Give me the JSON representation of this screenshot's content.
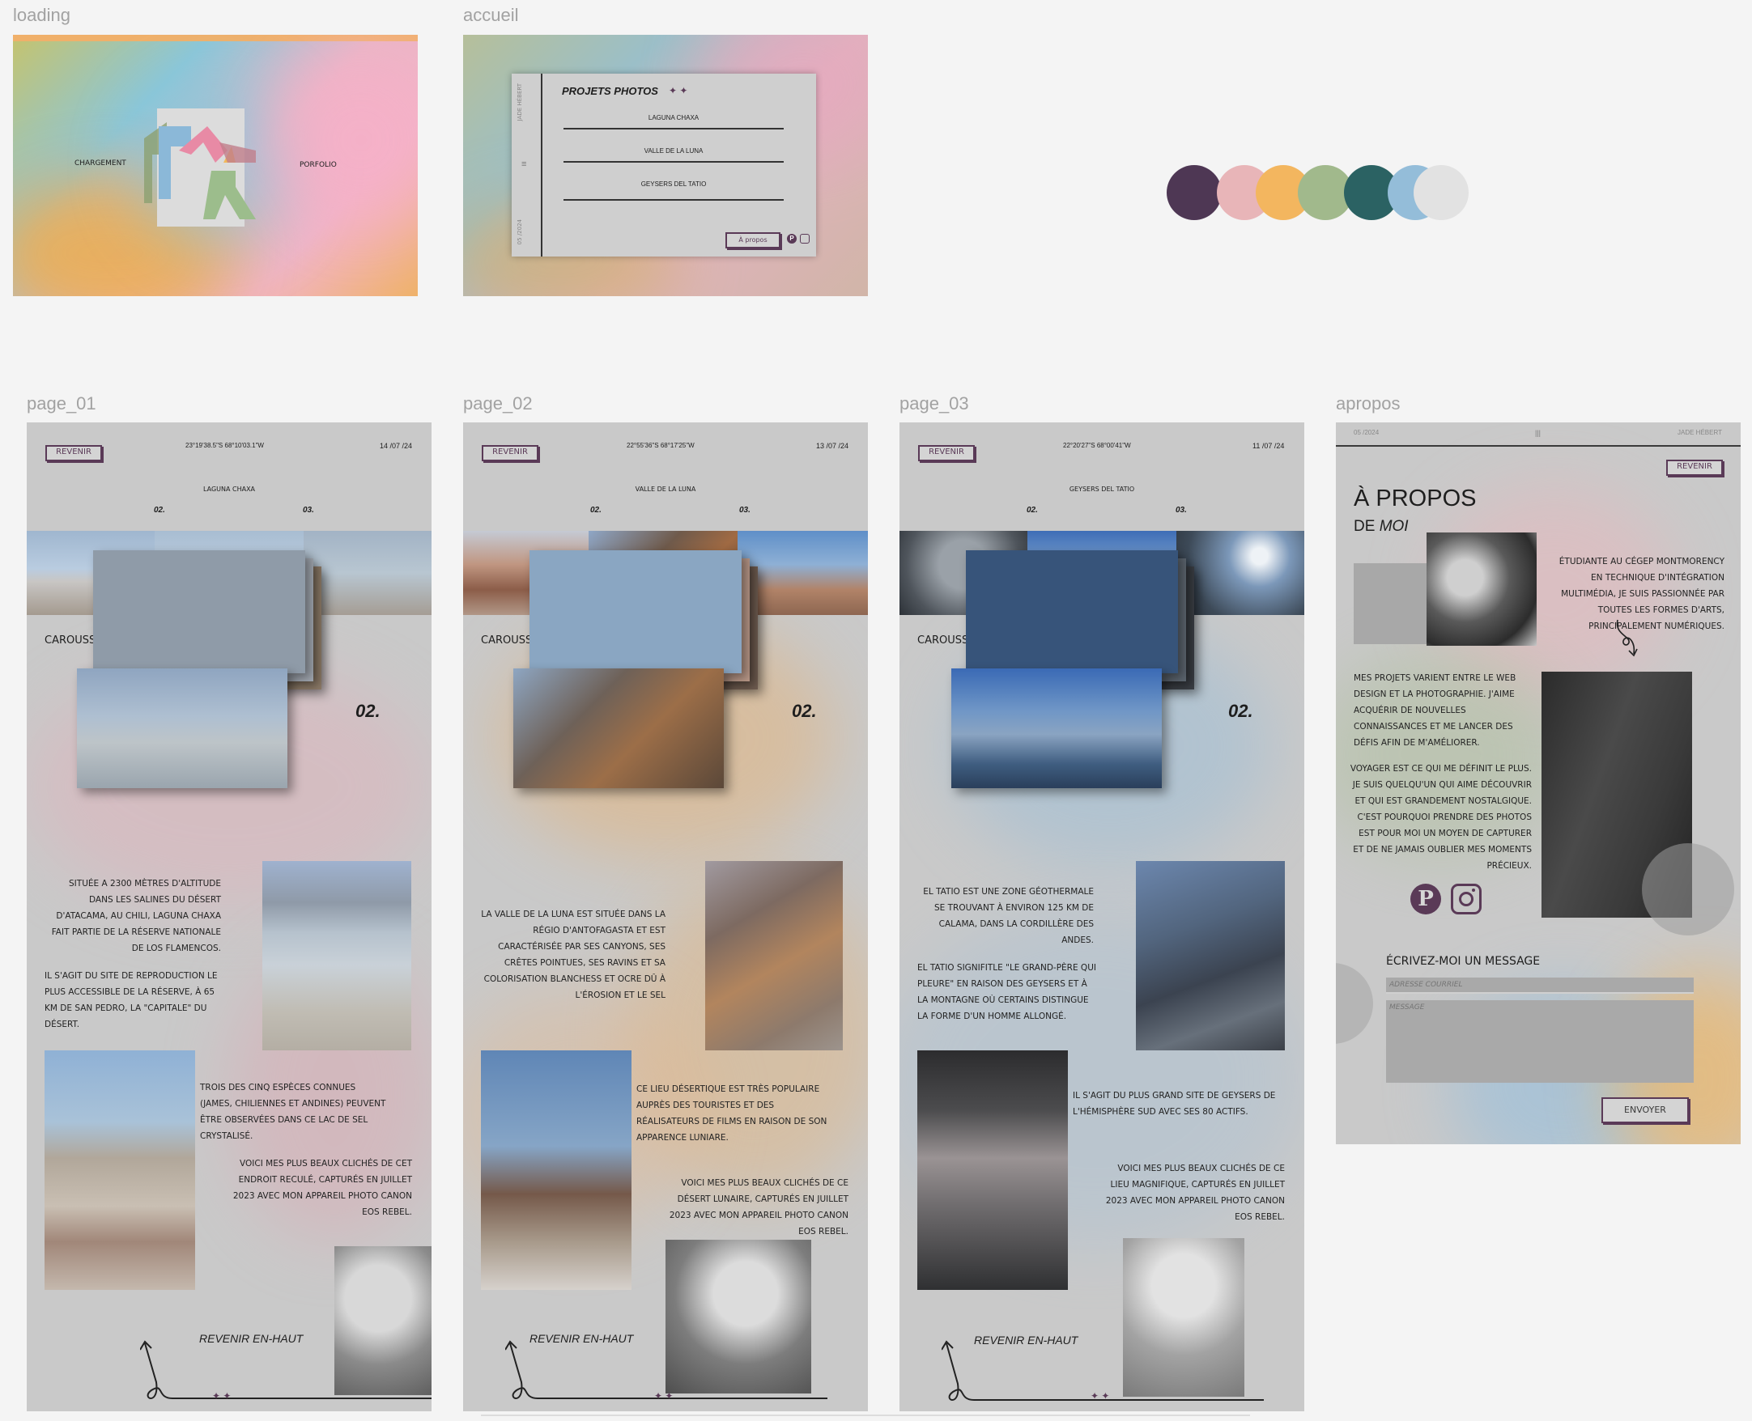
{
  "frames": {
    "loading": {
      "label": "loading",
      "left_text": "CHARGEMENT",
      "right_text": "PORFOLIO"
    },
    "accueil": {
      "label": "accueil",
      "title": "PROJETS PHOTOS",
      "stars": "✦ ✦",
      "side_name": "JADE HÉBERT",
      "side_date": "05 /2024",
      "menu": [
        "LAGUNA CHAXA",
        "VALLE DE LA LUNA",
        "GEYSERS DEL TATIO"
      ],
      "about_button": "À propos"
    },
    "page_01": {
      "label": "page_01",
      "back": "REVENIR",
      "coords": "23°19'38.5\"S 68°10'03.1\"W",
      "date": "14 /07 /24",
      "title": "LAGUNA CHAXA",
      "num_a": "02.",
      "num_b": "03.",
      "carousel": "CAROUSSEL  /  PILE",
      "big_num": "02.",
      "p1": "SITUÉE A 2300 MÈTRES D'ALTITUDE DANS LES SALINES DU DÉSERT D'ATACAMA, AU CHILI, LAGUNA CHAXA FAIT PARTIE DE LA RÉSERVE NATIONALE DE LOS FLAMENCOS.",
      "p2": "IL S'AGIT DU SITE DE REPRODUCTION LE PLUS ACCESSIBLE DE LA RÉSERVE, À 65 KM DE SAN PEDRO, LA \"CAPITALE\" DU DÉSERT.",
      "p3": "TROIS DES CINQ ESPÈCES CONNUES (JAMES, CHILIENNES ET ANDINES)  PEUVENT ÊTRE OBSERVÉES DANS CE LAC DE SEL CRYSTALISÉ.",
      "p4": "VOICI MES PLUS BEAUX CLICHÉS DE CET ENDROIT RECULÉ, CAPTURÉS EN JUILLET 2023 AVEC MON APPAREIL PHOTO CANON EOS REBEL.",
      "back_top": "REVENIR EN-HAUT",
      "stars": "✦ ✦"
    },
    "page_02": {
      "label": "page_02",
      "back": "REVENIR",
      "coords": "22°55'36\"S 68°17'25\"W",
      "date": "13 /07 /24",
      "title": "VALLE DE LA LUNA",
      "num_a": "02.",
      "num_b": "03.",
      "carousel": "CAROUSSEL  /  PILE",
      "big_num": "02.",
      "p1": "LA VALLE DE LA LUNA EST SITUÉE DANS LA RÉGIO D'ANTOFAGASTA ET EST CARACTÉRISÉE PAR SES CANYONS, SES CRÊTES POINTUES, SES RAVINS ET SA COLORISATION BLANCHESS ET OCRE DÛ À L'ÉROSION ET LE SEL",
      "p2": "CE LIEU DÉSERTIQUE EST TRÈS POPULAIRE AUPRÈS DES TOURISTES ET DES RÉALISATEURS DE FILMS EN RAISON DE SON APPARENCE LUNIARE.",
      "p3": "VOICI MES PLUS BEAUX CLICHÉS DE CE DÉSERT LUNAIRE, CAPTURÉS EN JUILLET 2023 AVEC MON APPAREIL PHOTO CANON EOS REBEL.",
      "back_top": "REVENIR EN-HAUT",
      "stars": "✦ ✦"
    },
    "page_03": {
      "label": "page_03",
      "back": "REVENIR",
      "coords": "22°20'27\"S 68°00'41\"W",
      "date": "11 /07 /24",
      "title": "GEYSERS DEL TATIO",
      "num_a": "02.",
      "num_b": "03.",
      "carousel": "CAROUSSEL  /  PILE",
      "big_num": "02.",
      "p1": "EL TATIO EST UNE ZONE GÉOTHERMALE SE TROUVANT À ENVIRON 125 KM DE CALAMA, DANS LA CORDILLÈRE DES ANDES.",
      "p2": "EL TATIO SIGNIFITLE \"LE GRAND-PÈRE QUI PLEURE\" EN RAISON DES GEYSERS ET À LA MONTAGNE OÙ CERTAINS DISTINGUE LA FORME D'UN HOMME ALLONGÉ.",
      "p3": "IL S'AGIT DU PLUS GRAND SITE DE GEYSERS DE L'HÉMISPHÈRE SUD AVEC SES 80 ACTIFS.",
      "p4": "VOICI MES PLUS BEAUX CLICHÉS DE CE LIEU MAGNIFIQUE, CAPTURÉS EN JUILLET 2023 AVEC MON APPAREIL PHOTO CANON EOS REBEL.",
      "back_top": "REVENIR EN-HAUT",
      "stars": "✦ ✦"
    },
    "apropos": {
      "label": "apropos",
      "date": "05 /2024",
      "handle": "|||",
      "name": "JADE HÉBERT",
      "back": "REVENIR",
      "title_a": "À PROPOS",
      "title_b": "DE",
      "title_c": "MOI",
      "p1": "ÉTUDIANTE AU CÉGEP MONTMORENCY EN TECHNIQUE D'INTÉGRATION MULTIMÉDIA, JE SUIS PASSIONNÉE PAR TOUTES LES FORMES D'ARTS, PRINCIPALEMENT NUMÉRIQUES.",
      "p2": "MES PROJETS VARIENT ENTRE LE WEB DESIGN ET LA PHOTOGRAPHIE. J'AIME ACQUÉRIR DE NOUVELLES CONNAISSANCES ET ME LANCER DES DÉFIS AFIN DE M'AMÉLIORER.",
      "p3": "VOYAGER EST CE QUI ME DÉFINIT LE PLUS. JE SUIS QUELQU'UN QUI AIME DÉCOUVRIR ET QUI EST GRANDEMENT NOSTALGIQUE. C'EST POURQUOI PRENDRE DES PHOTOS EST POUR MOI UN MOYEN DE CAPTURER ET DE NE JAMAIS OUBLIER MES MOMENTS PRÉCIEUX.",
      "form_title": "ÉCRIVEZ-MOI UN MESSAGE",
      "email_placeholder": "ADRESSE COURRIEL",
      "message_placeholder": "MESSAGE",
      "send": "ENVOYER"
    }
  },
  "palette": [
    "#4e3754",
    "#e8b5b8",
    "#f3b65f",
    "#a1b98c",
    "#2b6263",
    "#94bdd9",
    "#e2e2e2"
  ]
}
